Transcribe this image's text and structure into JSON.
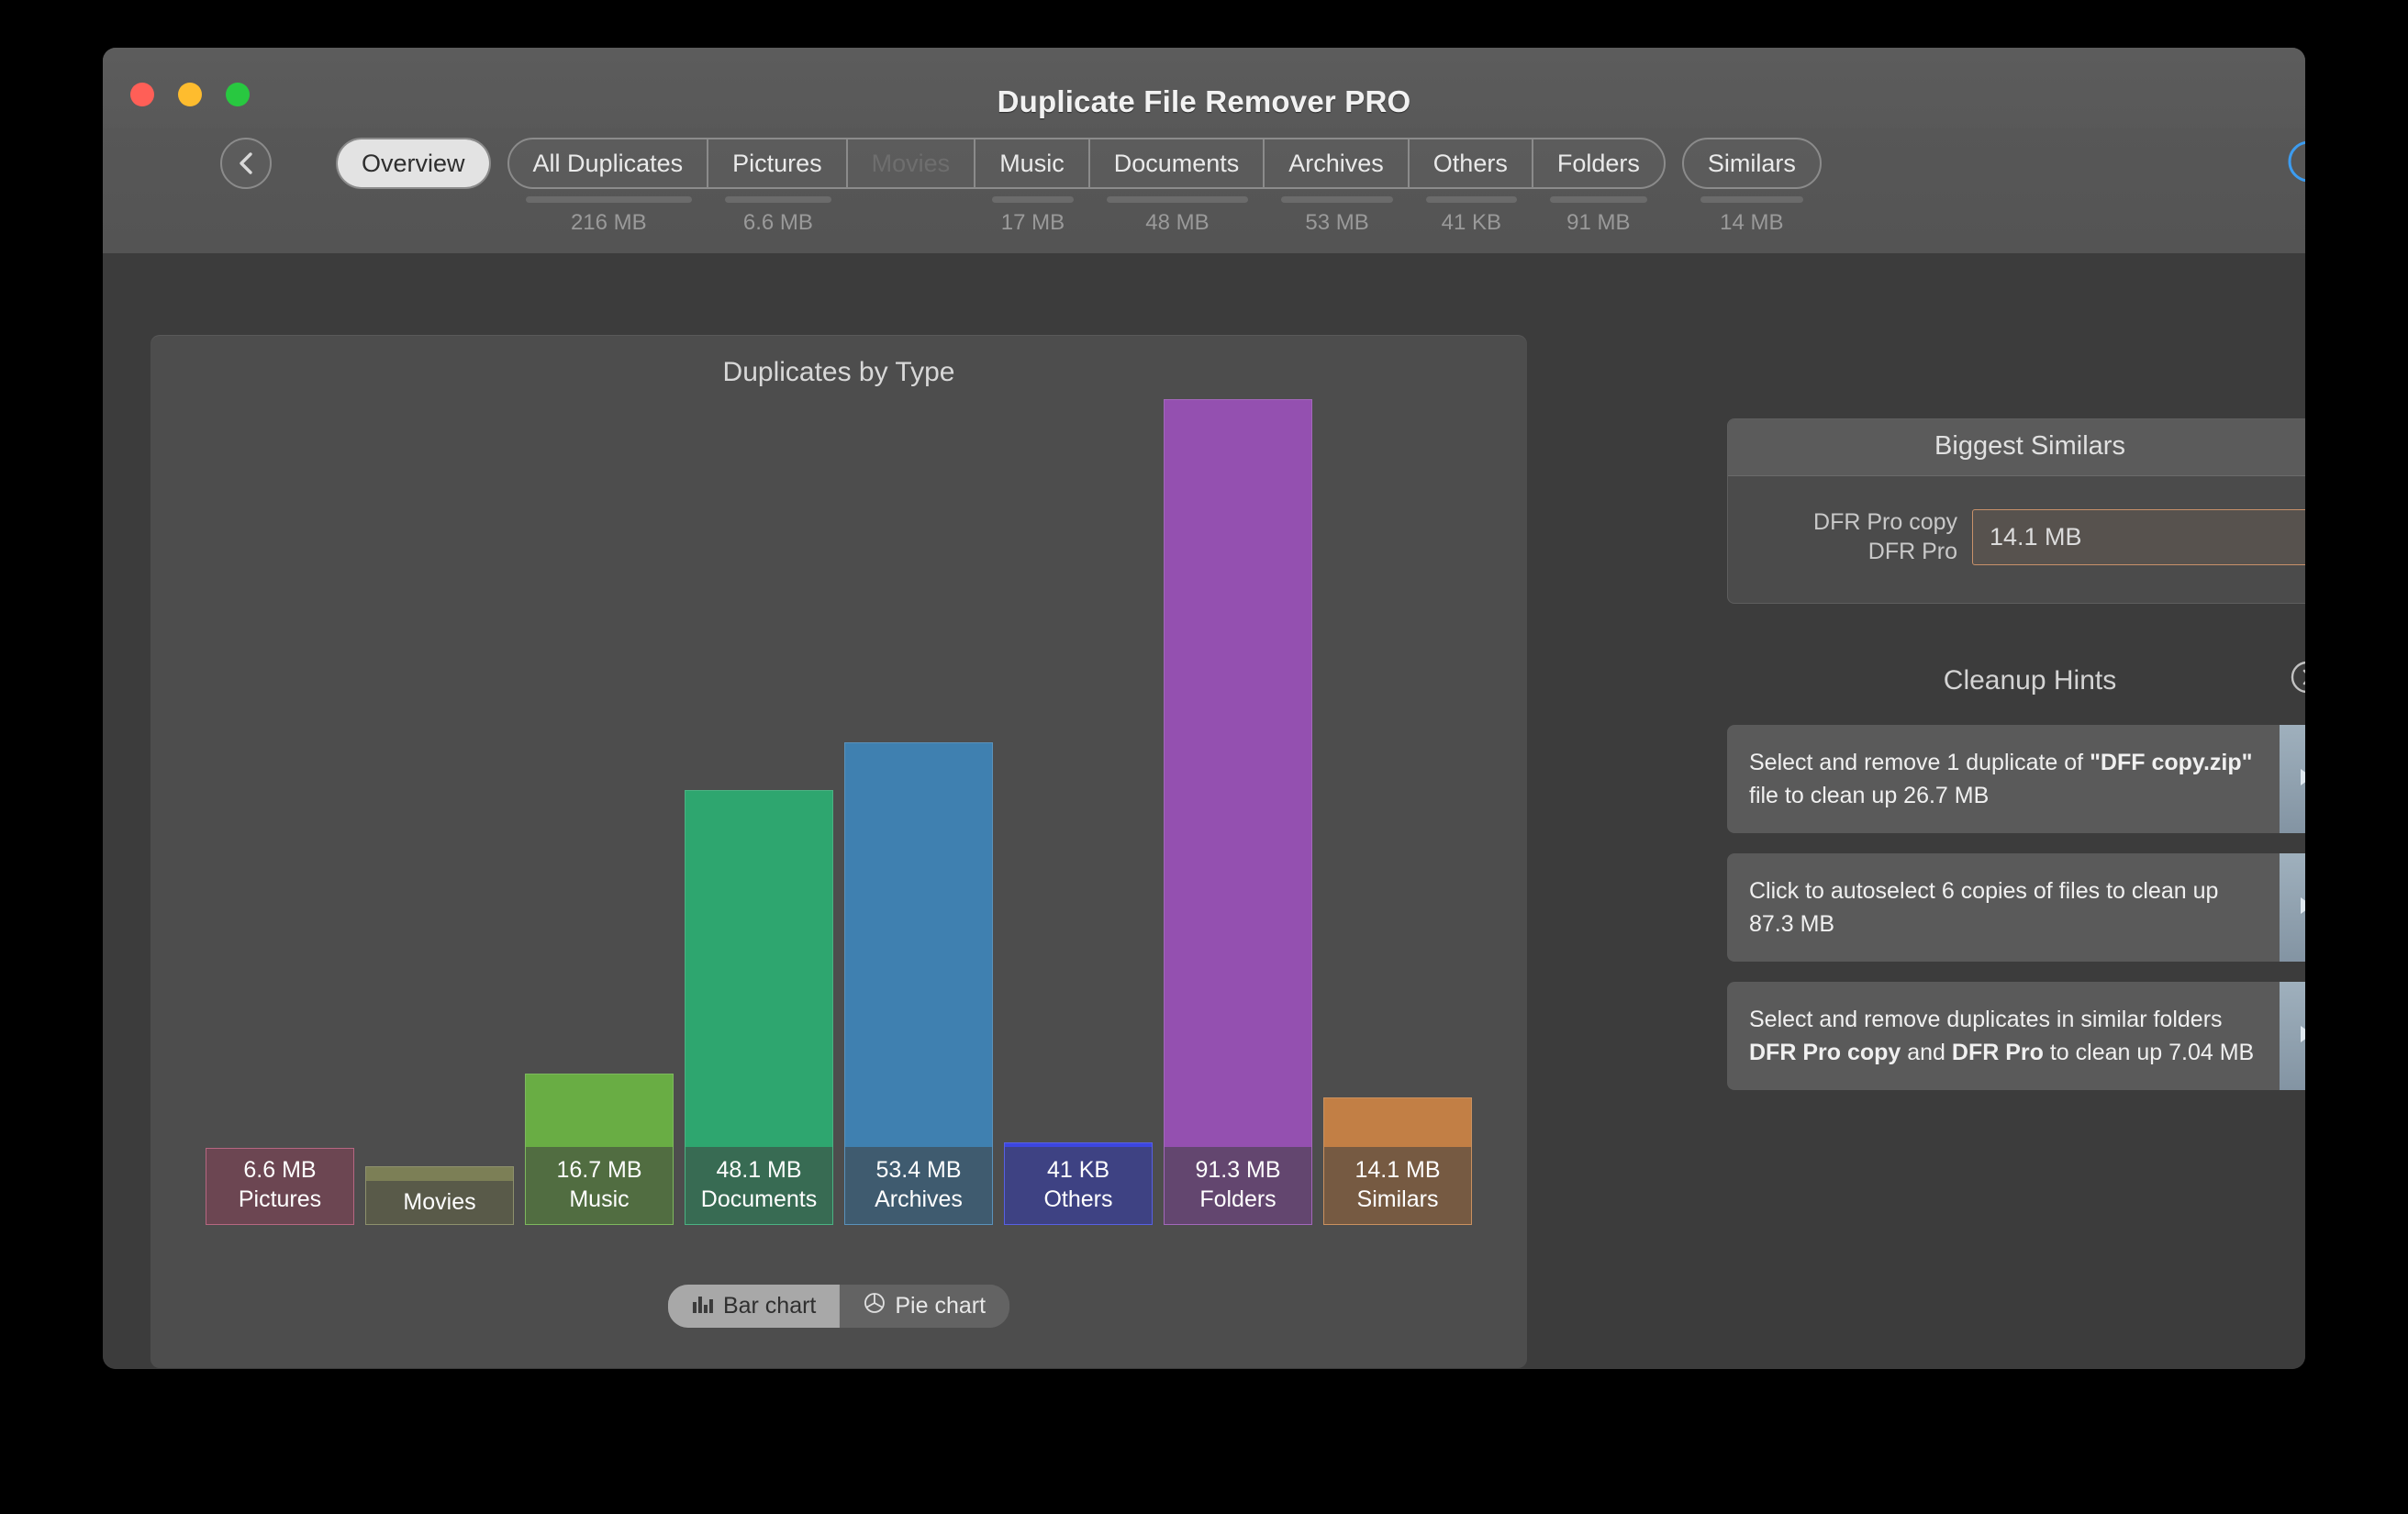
{
  "window": {
    "title": "Duplicate File Remover PRO",
    "traffic_lights": [
      "close",
      "minimize",
      "zoom"
    ]
  },
  "toolbar": {
    "back_icon": "chevron-left-icon",
    "info_icon": "info-icon",
    "rss_icon": "broadcast-icon",
    "tabs": [
      {
        "label": "Overview",
        "size": "",
        "selected": true,
        "disabled": false
      },
      {
        "label": "All Duplicates",
        "size": "216 MB",
        "selected": false,
        "disabled": false
      },
      {
        "label": "Pictures",
        "size": "6.6 MB",
        "selected": false,
        "disabled": false
      },
      {
        "label": "Movies",
        "size": "",
        "selected": false,
        "disabled": true
      },
      {
        "label": "Music",
        "size": "17 MB",
        "selected": false,
        "disabled": false
      },
      {
        "label": "Documents",
        "size": "48 MB",
        "selected": false,
        "disabled": false
      },
      {
        "label": "Archives",
        "size": "53 MB",
        "selected": false,
        "disabled": false
      },
      {
        "label": "Others",
        "size": "41 KB",
        "selected": false,
        "disabled": false
      },
      {
        "label": "Folders",
        "size": "91 MB",
        "selected": false,
        "disabled": false
      },
      {
        "label": "Similars",
        "size": "14 MB",
        "selected": false,
        "disabled": false
      }
    ]
  },
  "chart_data": {
    "type": "bar",
    "title": "Duplicates by Type",
    "xlabel": "",
    "ylabel": "",
    "grid": false,
    "legend": "none",
    "unit": "MB",
    "ylim": [
      0,
      91.3
    ],
    "categories": [
      "Pictures",
      "Movies",
      "Music",
      "Documents",
      "Archives",
      "Others",
      "Folders",
      "Similars"
    ],
    "values": [
      6.6,
      0,
      16.7,
      48.1,
      53.4,
      0.041,
      91.3,
      14.1
    ],
    "value_labels": [
      "6.6 MB",
      "",
      "16.7 MB",
      "48.1 MB",
      "53.4 MB",
      "41 KB",
      "91.3 MB",
      "14.1 MB"
    ],
    "colors": [
      "#aa4f6d",
      "#7c7f56",
      "#69ad44",
      "#2ea66f",
      "#3f80b0",
      "#3c46e0",
      "#9450b0",
      "#c27f45"
    ]
  },
  "chart_toggle": {
    "bar_label": "Bar chart",
    "pie_label": "Pie chart",
    "bar_icon": "bar-chart-icon",
    "pie_icon": "pie-chart-icon",
    "selected": "Bar chart"
  },
  "sidebar": {
    "biggest_similars": {
      "title": "Biggest Similars",
      "row": {
        "name_line1": "DFR Pro copy",
        "name_line2": "DFR Pro",
        "size": "14.1 MB"
      }
    },
    "cleanup_hints": {
      "title": "Cleanup Hints",
      "disclosure_icon": "chevron-right-circle-icon",
      "arrow_icon": "play-triangle-icon",
      "items": [
        {
          "parts": [
            {
              "t": "Select and remove 1 duplicate of ",
              "b": false
            },
            {
              "t": "\"DFF copy.zip\"",
              "b": true
            },
            {
              "t": " file to clean up 26.7 MB",
              "b": false
            }
          ]
        },
        {
          "parts": [
            {
              "t": "Click to autoselect 6 copies of files to clean up 87.3 MB",
              "b": false
            }
          ]
        },
        {
          "parts": [
            {
              "t": "Select and remove duplicates in similar folders ",
              "b": false
            },
            {
              "t": "DFR Pro copy",
              "b": true
            },
            {
              "t": " and ",
              "b": false
            },
            {
              "t": "DFR Pro",
              "b": true
            },
            {
              "t": " to clean up 7.04 MB",
              "b": false
            }
          ]
        }
      ]
    }
  },
  "colors": {
    "window_bg": "#3c3c3c",
    "panel_bg": "#4d4d4d",
    "toolbar_bg": "#575757",
    "accent_blue": "#3c9cf0",
    "similar_border": "#c8916a"
  }
}
